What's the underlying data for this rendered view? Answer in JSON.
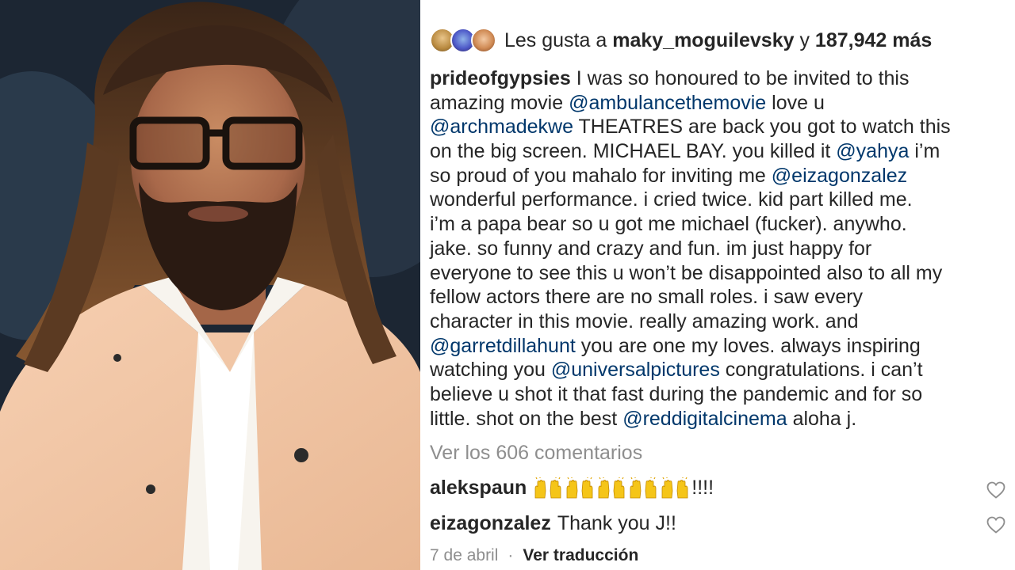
{
  "likes": {
    "prefix": "Les gusta a",
    "user": "maky_moguilevsky",
    "connector": "y",
    "count": "187,942 más"
  },
  "post": {
    "username": "prideofgypsies",
    "caption_lines": [
      [
        {
          "t": "I was so honoured to be invited to this"
        }
      ],
      [
        {
          "t": "amazing movie "
        },
        {
          "m": "@ambulancethemovie"
        },
        {
          "t": "  love u"
        }
      ],
      [
        {
          "m": "@archmadekwe"
        },
        {
          "t": " THEATRES are back  you got to watch this"
        }
      ],
      [
        {
          "t": "on the big screen. MICHAEL BAY.  you killed it  "
        },
        {
          "m": "@yahya"
        },
        {
          "t": " i’m"
        }
      ],
      [
        {
          "t": "so proud of you mahalo for inviting me  "
        },
        {
          "m": "@eizagonzalez"
        }
      ],
      [
        {
          "t": "wonderful performance. i cried twice.  kid part killed me."
        }
      ],
      [
        {
          "t": "i’m a papa bear so u got me michael (fucker). anywho."
        }
      ],
      [
        {
          "t": "jake. so funny and crazy and fun.  im just happy for"
        }
      ],
      [
        {
          "t": "everyone to see this u won’t be disappointed  also to all my"
        }
      ],
      [
        {
          "t": "fellow actors  there are no small roles.  i saw every"
        }
      ],
      [
        {
          "t": "character in this movie.  really amazing work.  and"
        }
      ],
      [
        {
          "m": "@garretdillahunt"
        },
        {
          "t": " you are one my loves.  always inspiring"
        }
      ],
      [
        {
          "t": "watching you "
        },
        {
          "m": "@universalpictures"
        },
        {
          "t": " congratulations. i can’t"
        }
      ],
      [
        {
          "t": "believe u shot it that fast during the pandemic and for so"
        }
      ],
      [
        {
          "t": "little.  shot on the best "
        },
        {
          "m": "@reddigitalcinema"
        },
        {
          "t": "  aloha j."
        }
      ]
    ]
  },
  "view_comments": "Ver los 606 comentarios",
  "comments": [
    {
      "user": "alekspaun",
      "emoji": "raising-hands-icon",
      "emoji_count": 5,
      "text": "!!!!"
    },
    {
      "user": "eizagonzalez",
      "text": "Thank you J!!"
    }
  ],
  "footer": {
    "date": "7 de abril",
    "separator": "·",
    "translate": "Ver traducción"
  },
  "colors": {
    "text": "#262626",
    "mention": "#00376b",
    "secondary": "#8e8e8e",
    "emoji": "#f5c518"
  }
}
